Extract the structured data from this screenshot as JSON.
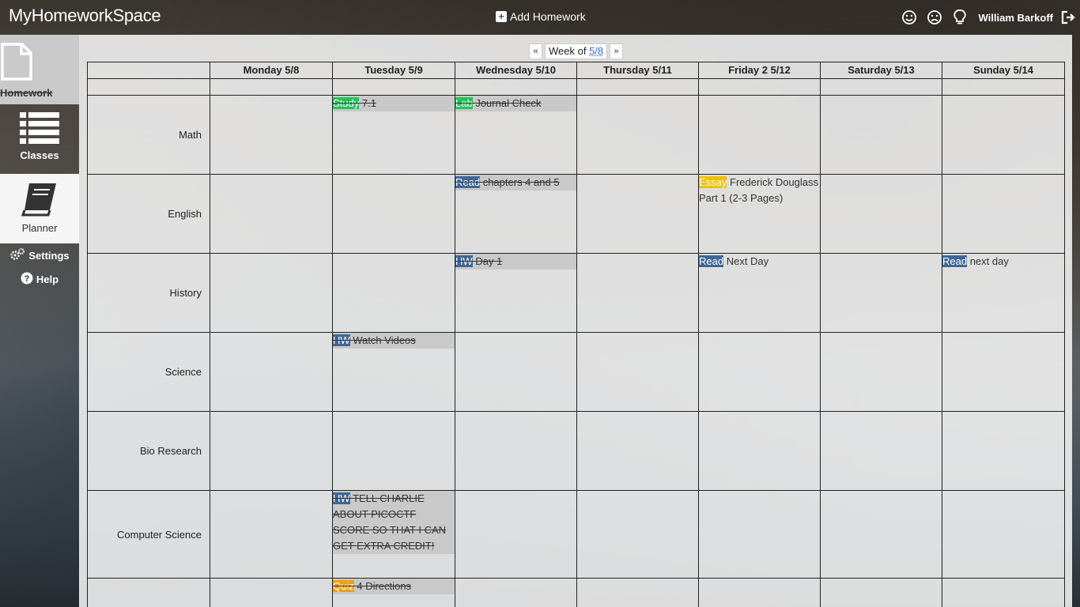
{
  "app": {
    "brand": "MyHomeworkSpace"
  },
  "topbar": {
    "add_homework": "Add Homework",
    "user_name": "William Barkoff",
    "icons": [
      "smile-icon",
      "frown-icon",
      "lightbulb-icon",
      "logout-icon"
    ]
  },
  "sidebar": {
    "items": [
      {
        "label": "Homework",
        "icon": "document-icon"
      },
      {
        "label": "Classes",
        "icon": "list-icon"
      },
      {
        "label": "Planner",
        "icon": "book-icon"
      }
    ],
    "settings": "Settings",
    "help": "Help"
  },
  "week_nav": {
    "prev": "«",
    "label": "Week of",
    "date": "5/8",
    "next": "»"
  },
  "days": [
    "Monday 5/8",
    "Tuesday 5/9",
    "Wednesday 5/10",
    "Thursday 5/11",
    "Friday 2 5/12",
    "Saturday 5/13",
    "Sunday 5/14"
  ],
  "classes": [
    {
      "name": "Math",
      "cells": [
        [],
        [
          {
            "tag": "Study",
            "color": "#22c45a",
            "text": "7.1",
            "done": true
          }
        ],
        [
          {
            "tag": "Lab",
            "color": "#22c45a",
            "text": "Journal Check",
            "done": true
          }
        ],
        [],
        [],
        [],
        []
      ]
    },
    {
      "name": "English",
      "cells": [
        [],
        [],
        [
          {
            "tag": "Read",
            "color": "#3e6797",
            "text": "chapters 4 and 5",
            "done": true
          }
        ],
        [],
        [
          {
            "tag": "Essay",
            "color": "#f0c000",
            "text": "Frederick Douglass Part 1 (2-3 Pages)",
            "done": false
          }
        ],
        [],
        []
      ]
    },
    {
      "name": "History",
      "cells": [
        [],
        [],
        [
          {
            "tag": "HW",
            "color": "#3e6797",
            "text": "Day 1",
            "done": true
          }
        ],
        [],
        [
          {
            "tag": "Read",
            "color": "#3e6797",
            "text": "Next Day",
            "done": false
          }
        ],
        [],
        [
          {
            "tag": "Read",
            "color": "#3e6797",
            "text": "next day",
            "done": false
          }
        ]
      ]
    },
    {
      "name": "Science",
      "cells": [
        [],
        [
          {
            "tag": "HW",
            "color": "#3e6797",
            "text": "Watch Videos",
            "done": true
          }
        ],
        [],
        [],
        [],
        [],
        []
      ]
    },
    {
      "name": "Bio Research",
      "cells": [
        [],
        [],
        [],
        [],
        [],
        [],
        []
      ]
    },
    {
      "name": "Computer Science",
      "cells": [
        [],
        [
          {
            "tag": "HW",
            "color": "#3e6797",
            "text": "TELL CHARLIE ABOUT PICOCTF SCORE SO THAT I CAN GET EXTRA CREDIT!",
            "done": true
          }
        ],
        [],
        [],
        [],
        [],
        []
      ]
    },
    {
      "name": "",
      "cells": [
        [],
        [
          {
            "tag": "Quiz",
            "color": "#f39c12",
            "text": "4 Directions",
            "done": true
          }
        ],
        [],
        [],
        [],
        [],
        []
      ]
    }
  ]
}
